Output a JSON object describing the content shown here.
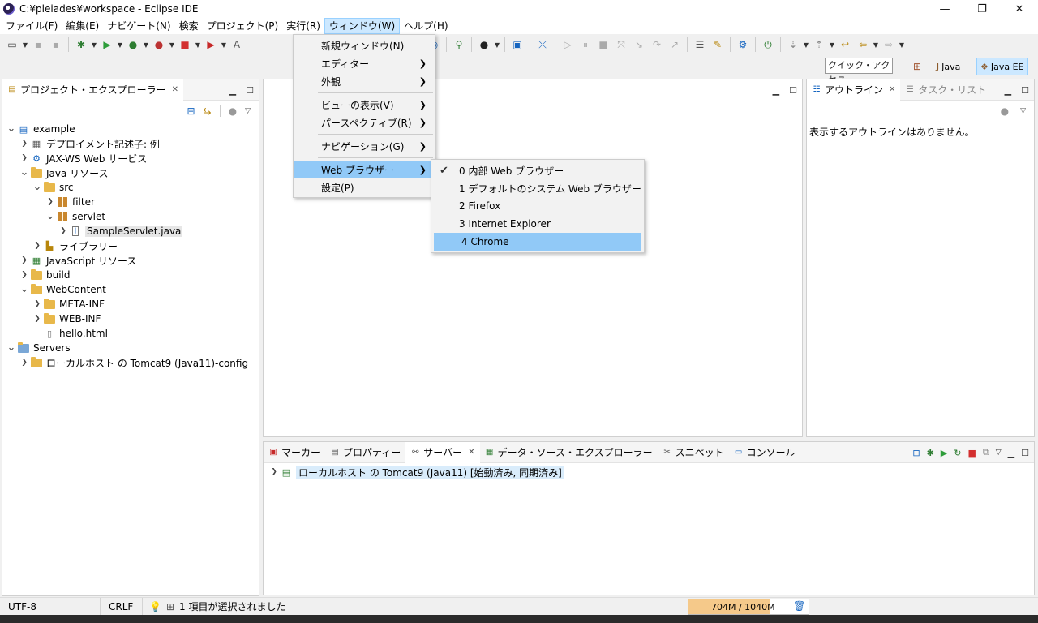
{
  "window": {
    "title": "C:¥pleiades¥workspace - Eclipse IDE"
  },
  "menubar": [
    "ファイル(F)",
    "編集(E)",
    "ナビゲート(N)",
    "検索",
    "プロジェクト(P)",
    "実行(R)",
    "ウィンドウ(W)",
    "ヘルプ(H)"
  ],
  "toolbar2": {
    "quick_access": "クイック・アクセス",
    "perspectives": [
      "Java",
      "Java EE"
    ]
  },
  "project_explorer": {
    "tab_label": "プロジェクト・エクスプローラー",
    "tree": [
      {
        "label": "example",
        "indent": 0,
        "twisty": "down",
        "icon": "project"
      },
      {
        "label": "デプロイメント記述子: 例",
        "indent": 1,
        "twisty": "right",
        "icon": "descriptor"
      },
      {
        "label": "JAX-WS Web サービス",
        "indent": 1,
        "twisty": "right",
        "icon": "webservice"
      },
      {
        "label": "Java リソース",
        "indent": 1,
        "twisty": "down",
        "icon": "java-resources"
      },
      {
        "label": "src",
        "indent": 2,
        "twisty": "down",
        "icon": "src-folder"
      },
      {
        "label": "filter",
        "indent": 3,
        "twisty": "right",
        "icon": "package"
      },
      {
        "label": "servlet",
        "indent": 3,
        "twisty": "down",
        "icon": "package"
      },
      {
        "label": "SampleServlet.java",
        "indent": 4,
        "twisty": "right",
        "icon": "java-file",
        "selected": true
      },
      {
        "label": "ライブラリー",
        "indent": 2,
        "twisty": "right",
        "icon": "library"
      },
      {
        "label": "JavaScript リソース",
        "indent": 1,
        "twisty": "right",
        "icon": "js-resources"
      },
      {
        "label": "build",
        "indent": 1,
        "twisty": "right",
        "icon": "folder"
      },
      {
        "label": "WebContent",
        "indent": 1,
        "twisty": "down",
        "icon": "folder"
      },
      {
        "label": "META-INF",
        "indent": 2,
        "twisty": "right",
        "icon": "folder"
      },
      {
        "label": "WEB-INF",
        "indent": 2,
        "twisty": "right",
        "icon": "folder"
      },
      {
        "label": "hello.html",
        "indent": 2,
        "twisty": "",
        "icon": "html-file"
      },
      {
        "label": "Servers",
        "indent": 0,
        "twisty": "down",
        "icon": "servers-folder"
      },
      {
        "label": "ローカルホスト の Tomcat9 (Java11)-config",
        "indent": 1,
        "twisty": "right",
        "icon": "folder"
      }
    ]
  },
  "outline": {
    "tab_label": "アウトライン",
    "tab2_label": "タスク・リスト",
    "empty_message": "表示するアウトラインはありません。"
  },
  "bottom_panel": {
    "tabs": [
      "マーカー",
      "プロパティー",
      "サーバー",
      "データ・ソース・エクスプローラー",
      "スニペット",
      "コンソール"
    ],
    "active_tab": "サーバー",
    "server_row": "ローカルホスト の Tomcat9 (Java11)  [始動済み, 同期済み]"
  },
  "window_menu": {
    "items": [
      "新規ウィンドウ(N)",
      "エディター",
      "外観",
      "ビューの表示(V)",
      "パースペクティブ(R)",
      "ナビゲーション(G)",
      "Web ブラウザー",
      "設定(P)"
    ]
  },
  "browser_submenu": {
    "items": [
      "0 内部 Web ブラウザー",
      "1 デフォルトのシステム Web ブラウザー",
      "2 Firefox",
      "3 Internet Explorer",
      "4 Chrome"
    ]
  },
  "statusbar": {
    "encoding": "UTF-8",
    "line_delimiter": "CRLF",
    "selection": "1 項目が選択されました",
    "heap": "704M / 1040M",
    "heap_fraction": 0.68
  },
  "colors": {
    "menu_highlight": "#91c9f7",
    "menubar_active": "#cce8ff",
    "selection_gray": "#e6e6e6"
  }
}
